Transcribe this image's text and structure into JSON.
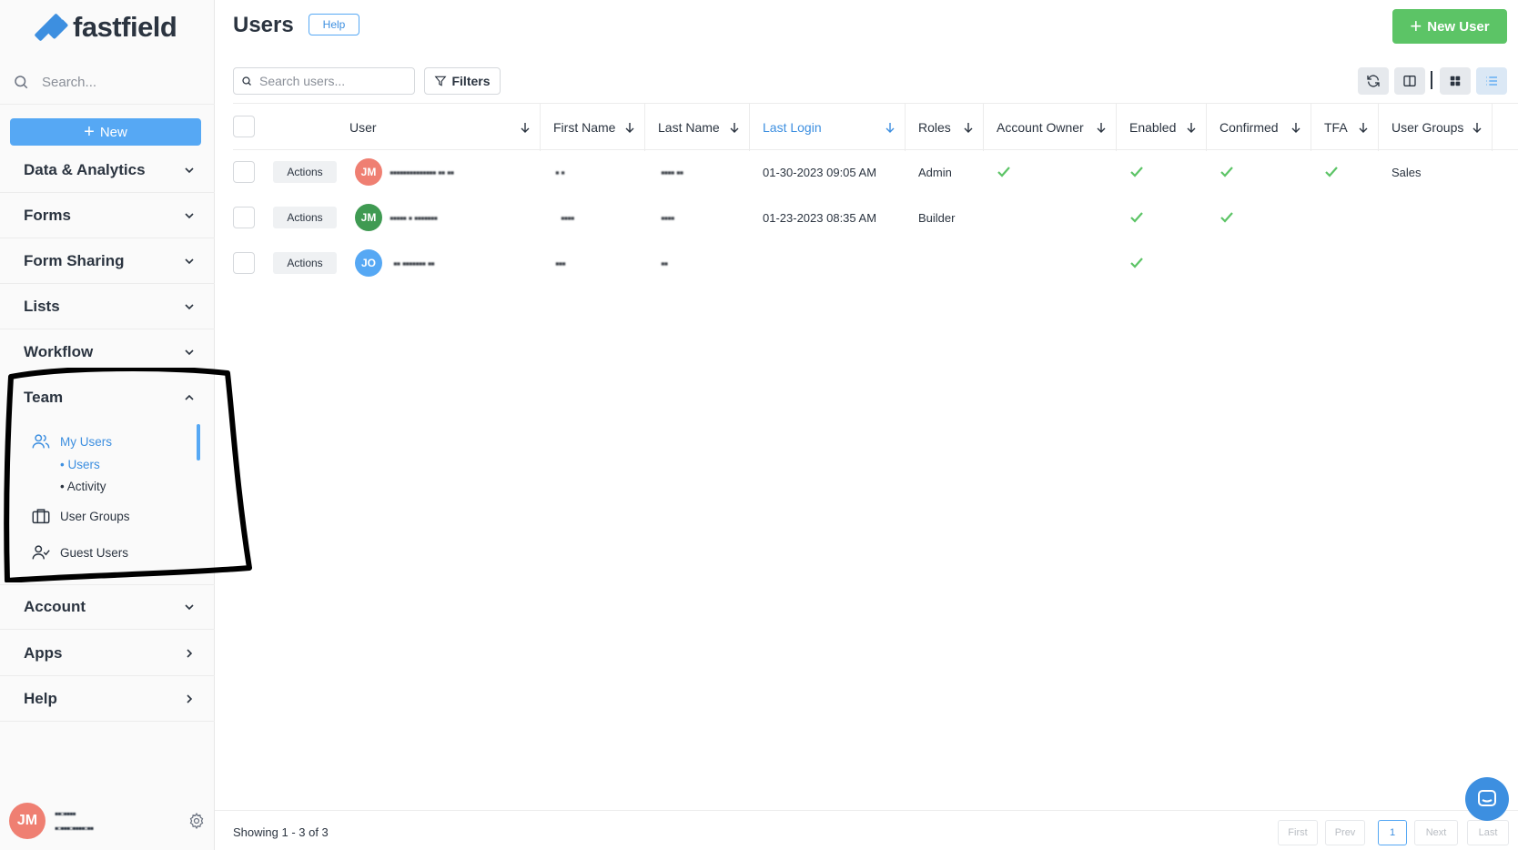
{
  "brand": {
    "name": "fastfield"
  },
  "sidebar": {
    "search_placeholder": "Search...",
    "new_label": "New",
    "sections": [
      {
        "label": "Data & Analytics",
        "state": "collapsed"
      },
      {
        "label": "Forms",
        "state": "collapsed"
      },
      {
        "label": "Form Sharing",
        "state": "collapsed"
      },
      {
        "label": "Lists",
        "state": "collapsed"
      },
      {
        "label": "Workflow",
        "state": "collapsed"
      },
      {
        "label": "Team",
        "state": "expanded"
      },
      {
        "label": "Account",
        "state": "collapsed"
      },
      {
        "label": "Apps",
        "state": "arrow"
      },
      {
        "label": "Help",
        "state": "arrow"
      }
    ],
    "team_items": {
      "my_users": "My Users",
      "users": "Users",
      "activity": "Activity",
      "user_groups": "User Groups",
      "guest_users": "Guest Users"
    },
    "user": {
      "initials": "JM",
      "name_redacted": "▪▪▫▪▪▪▪",
      "email_redacted": "▪▫▪▪▪▫▪▪▪▪▫▪▪"
    }
  },
  "header": {
    "title": "Users",
    "help_label": "Help",
    "new_user_label": "New User",
    "search_placeholder": "Search users...",
    "filters_label": "Filters"
  },
  "table": {
    "columns": [
      "User",
      "First Name",
      "Last Name",
      "Last Login",
      "Roles",
      "Account Owner",
      "Enabled",
      "Confirmed",
      "TFA",
      "User Groups"
    ],
    "sorted_column": "Last Login",
    "actions_label": "Actions",
    "rows": [
      {
        "initials": "JM",
        "avatar_color": "#ef7f72",
        "user_redacted": "▪▪▪▪▪▪▪▪▪▪▪▪▪▪ ▪▪ ▪▪",
        "first_redacted": "▪ ▪",
        "last_redacted": "▪▪▪▪ ▪▪",
        "last_login": "01-30-2023 09:05 AM",
        "role": "Admin",
        "account_owner": true,
        "enabled": true,
        "confirmed": true,
        "tfa": true,
        "group": "Sales"
      },
      {
        "initials": "JM",
        "avatar_color": "#3f9a52",
        "user_redacted": "▪▪▪▪▪ ▪   ▪▪▪▪▪▪▪",
        "first_redacted": "▪▪▪▪",
        "last_redacted": "▪▪▪▪",
        "last_login": "01-23-2023 08:35 AM",
        "role": "Builder",
        "account_owner": false,
        "enabled": true,
        "confirmed": true,
        "tfa": false,
        "group": ""
      },
      {
        "initials": "JO",
        "avatar_color": "#56a8f4",
        "user_redacted": "▪▪ ▪▪▪▪▪▪▪ ▪▪",
        "first_redacted": "▪▪▪",
        "last_redacted": "▪▪",
        "last_login": "",
        "role": "",
        "account_owner": false,
        "enabled": true,
        "confirmed": false,
        "tfa": false,
        "group": ""
      }
    ]
  },
  "footer": {
    "showing": "Showing 1 - 3 of 3",
    "pagination": {
      "first": "First",
      "prev": "Prev",
      "current": "1",
      "next": "Next",
      "last": "Last"
    }
  },
  "colors": {
    "accent": "#56a8f4",
    "success": "#5cc466",
    "text": "#2b3440"
  },
  "icons": [
    "search-icon",
    "plus-icon",
    "chevron-down-icon",
    "chevron-up-icon",
    "chevron-right-icon",
    "users-icon",
    "briefcase-icon",
    "user-check-icon",
    "gear-icon",
    "filter-icon",
    "refresh-icon",
    "columns-icon",
    "grid-icon",
    "list-icon",
    "sort-arrow-icon",
    "check-icon",
    "chat-icon"
  ]
}
